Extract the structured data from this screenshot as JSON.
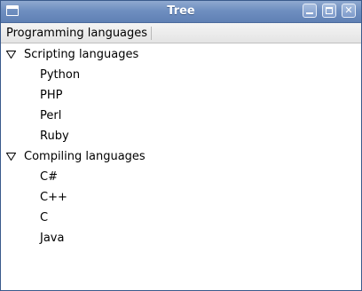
{
  "window": {
    "title": "Tree",
    "icons": {
      "app": "window-icon",
      "minimize": "minimize-icon",
      "maximize": "maximize-icon",
      "close": "close-icon"
    },
    "close_glyph": "✕"
  },
  "header": {
    "column_label": "Programming languages"
  },
  "tree": {
    "groups": [
      {
        "label": "Scripting languages",
        "expanded": true,
        "children": [
          "Python",
          "PHP",
          "Perl",
          "Ruby"
        ]
      },
      {
        "label": "Compiling languages",
        "expanded": true,
        "children": [
          "C#",
          "C++",
          "C",
          "Java"
        ]
      }
    ]
  },
  "colors": {
    "titlebar": "#6f8fc0",
    "header_bg": "#ececec",
    "text": "#000000",
    "background": "#ffffff"
  }
}
